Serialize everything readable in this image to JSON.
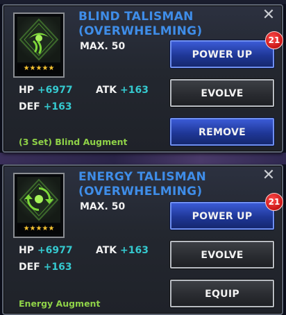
{
  "colors": {
    "title_blue": "#3f8de8",
    "stat_value_cyan": "#35c9cf",
    "augment_green": "#8fd248",
    "star_gold": "#f6c431",
    "badge_red": "#d01c1c"
  },
  "items": [
    {
      "name_line1": "BLIND TALISMAN",
      "name_line2": "(OVERWHELMING)",
      "max_level": "MAX. 50",
      "stars": "★★★★★",
      "icon": "eye-talisman-icon",
      "stats": {
        "hp_label": "HP",
        "hp_value": "+6977",
        "atk_label": "ATK",
        "atk_value": "+163",
        "def_label": "DEF",
        "def_value": "+163"
      },
      "augment": "(3 Set) Blind Augment",
      "buttons": {
        "power_up": "POWER UP",
        "evolve": "EVOLVE",
        "action": "REMOVE"
      },
      "badge_count": "21",
      "close_icon": "close-icon"
    },
    {
      "name_line1": "ENERGY TALISMAN",
      "name_line2": "(OVERWHELMING)",
      "max_level": "MAX. 50",
      "stars": "★★★★★",
      "icon": "energy-talisman-icon",
      "stats": {
        "hp_label": "HP",
        "hp_value": "+6977",
        "atk_label": "ATK",
        "atk_value": "+163",
        "def_label": "DEF",
        "def_value": "+163"
      },
      "augment": "Energy Augment",
      "buttons": {
        "power_up": "POWER UP",
        "evolve": "EVOLVE",
        "action": "EQUIP"
      },
      "badge_count": "21",
      "close_icon": "close-icon"
    }
  ]
}
